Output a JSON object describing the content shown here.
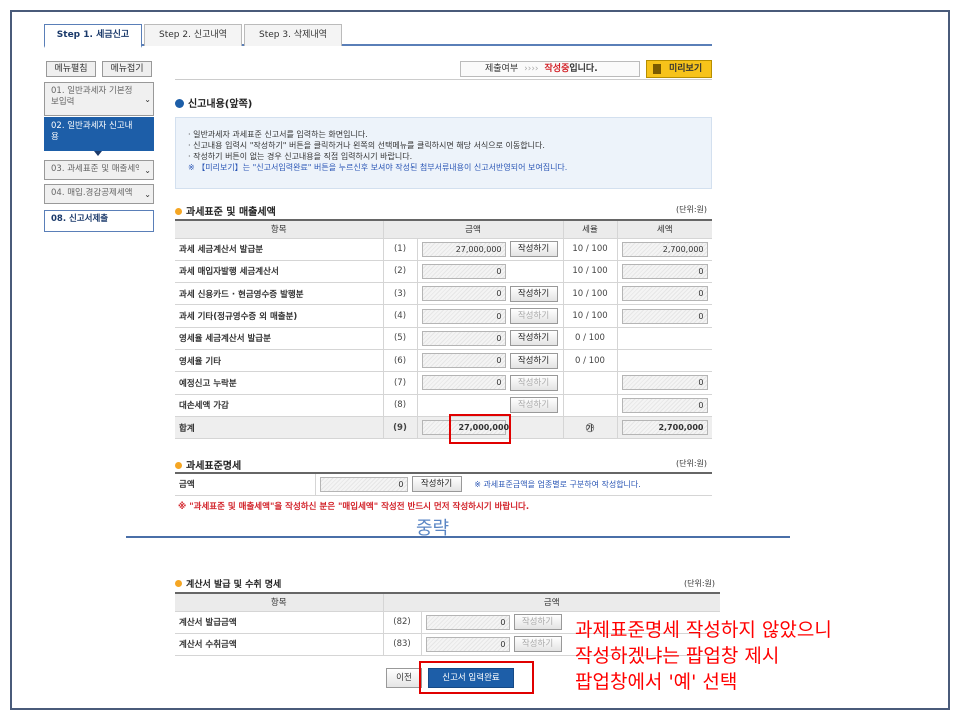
{
  "tabs": [
    {
      "label": "Step 1. 세금신고",
      "active": true
    },
    {
      "label": "Step 2. 신고내역",
      "active": false
    },
    {
      "label": "Step 3. 삭제내역",
      "active": false
    }
  ],
  "menu": {
    "expand_label": "메뉴펼침",
    "collapse_label": "메뉴접기",
    "items": [
      {
        "label": "01. 일반과세자 기본정보입력"
      },
      {
        "label": "02. 일반과세자 신고내용"
      },
      {
        "label": "03. 과세표준 및 매출세액"
      },
      {
        "label": "04. 매입.경감공제세액"
      },
      {
        "label": "08. 신고서제출"
      }
    ]
  },
  "status": {
    "label": "제출여부",
    "arrows": "››››",
    "state_strong": "작성중",
    "state_suffix": "입니다.",
    "preview_label": "미리보기"
  },
  "section_title": "신고내용(앞쪽)",
  "info_lines": [
    "· 일반과세자 과세표준 신고서를 입력하는 화면입니다.",
    "· 신고내용 입력시 \"작성하기\" 버튼을 클릭하거나 왼쪽의 선택메뉴를 클릭하시면 해당 서식으로 이동합니다.",
    "· 작성하기 버튼이 없는 경우 신고내용을 직접 입력하시기 바랍니다."
  ],
  "info_note": "※ 【미리보기】는 \"신고서입력완료\" 버튼을 누르신후 보셔야 작성된 첨부서류내용이 신고서반영되어 보여집니다.",
  "tax_table": {
    "title": "과세표준 및 매출세액",
    "unit": "(단위:원)",
    "headers": [
      "항목",
      "금액",
      "세율",
      "세액"
    ],
    "write_label": "작성하기",
    "rows": [
      {
        "label": "과세 세금계산서 발급분",
        "no": "(1)",
        "amount": "27,000,000",
        "rate": "10 / 100",
        "tax": "2,700,000"
      },
      {
        "label": "과세 매입자발행 세금계산서",
        "no": "(2)",
        "amount": "0",
        "rate": "10 / 100",
        "tax": "0"
      },
      {
        "label": "과세 신용카드 · 현금영수증 발행분",
        "no": "(3)",
        "amount": "0",
        "rate": "10 / 100",
        "tax": "0"
      },
      {
        "label": "과세 기타(정규영수증 외 매출분)",
        "no": "(4)",
        "amount": "0",
        "rate": "10 / 100",
        "tax": "0"
      },
      {
        "label": "영세율 세금계산서 발급분",
        "no": "(5)",
        "amount": "0",
        "rate": "0 / 100",
        "tax": ""
      },
      {
        "label": "영세율 기타",
        "no": "(6)",
        "amount": "0",
        "rate": "0 / 100",
        "tax": ""
      },
      {
        "label": "예정신고 누락분",
        "no": "(7)",
        "amount": "0",
        "rate": "",
        "tax": "0"
      },
      {
        "label": "대손세액 가감",
        "no": "(8)",
        "amount": "",
        "rate": "",
        "tax": "0"
      },
      {
        "label": "합계",
        "no": "(9)",
        "amount": "27,000,000",
        "rate": "㉮",
        "tax": "2,700,000"
      }
    ]
  },
  "base_table": {
    "title": "과세표준명세",
    "unit": "(단위:원)",
    "label": "금액",
    "amount": "0",
    "write_label": "작성하기",
    "hint": "※ 과세표준금액을 업종별로 구분하여 작성합니다."
  },
  "warning": "※ \"과세표준 및 매출세액\"을 작성하신 분은 \"매입세액\" 작성전 반드시 먼저 작성하시기 바랍니다.",
  "omitted": "중략",
  "invoice_table": {
    "title": "계산서 발급 및 수취 명세",
    "unit": "(단위:원)",
    "headers": [
      "항목",
      "금액"
    ],
    "write_label": "작성하기",
    "rows": [
      {
        "label": "계산서 발급금액",
        "no": "(82)",
        "amount": "0"
      },
      {
        "label": "계산서 수취금액",
        "no": "(83)",
        "amount": "0"
      }
    ]
  },
  "buttons": {
    "prev": "이전",
    "complete": "신고서 입력완료"
  },
  "callout_lines": [
    "과제표준명세 작성하지 않았으니",
    "작성하겠냐는 팝업창 제시",
    "팝업창에서 '예' 선택"
  ]
}
